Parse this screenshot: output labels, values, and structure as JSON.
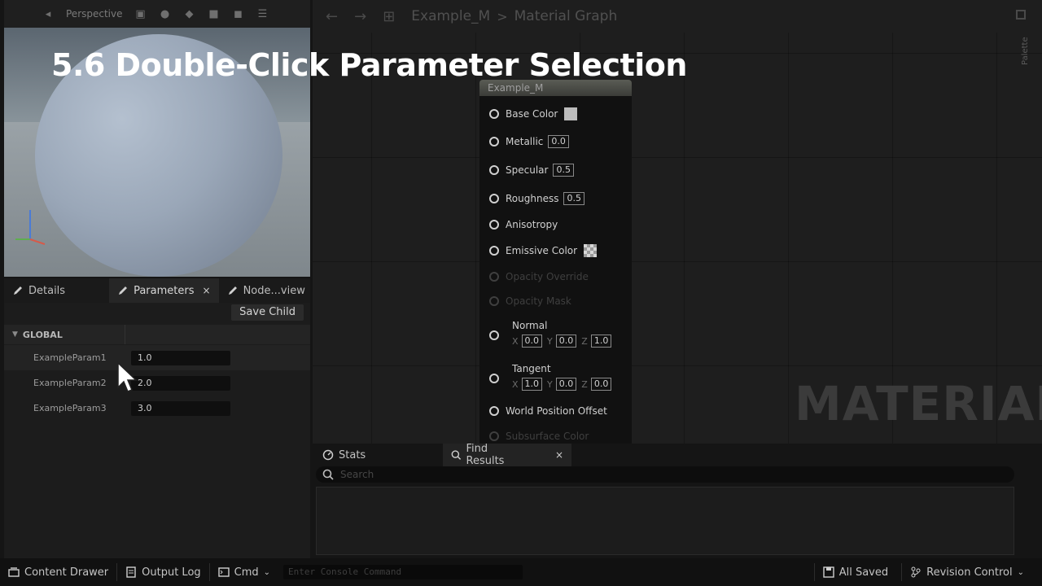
{
  "overlay_title": "5.6 Double-Click Parameter Selection",
  "viewport": {
    "mode_label": "Perspective"
  },
  "left_tabs": [
    {
      "label": "Details"
    },
    {
      "label": "Parameters",
      "close": "×"
    },
    {
      "label": "Node...view"
    }
  ],
  "params": {
    "save_child_label": "Save Child",
    "group_label": "GLOBAL",
    "rows": [
      {
        "name": "ExampleParam1",
        "value": "1.0"
      },
      {
        "name": "ExampleParam2",
        "value": "2.0"
      },
      {
        "name": "ExampleParam3",
        "value": "3.0"
      }
    ]
  },
  "graph": {
    "breadcrumb_root": "Example_M",
    "breadcrumb_sep": ">",
    "breadcrumb_leaf": "Material Graph",
    "palette_label": "Palette",
    "watermark": "MATERIAL"
  },
  "node": {
    "title": "Example_M",
    "pins": [
      {
        "label": "Base Color"
      },
      {
        "label": "Metallic",
        "value": "0.0"
      },
      {
        "label": "Specular",
        "value": "0.5"
      },
      {
        "label": "Roughness",
        "value": "0.5"
      },
      {
        "label": "Anisotropy"
      },
      {
        "label": "Emissive Color"
      },
      {
        "label": "Opacity Override"
      },
      {
        "label": "Opacity Mask"
      },
      {
        "label": "Normal",
        "x": "0.0",
        "y": "0.0",
        "z": "1.0"
      },
      {
        "label": "Tangent",
        "x": "1.0",
        "y": "0.0",
        "z": "0.0"
      },
      {
        "label": "World Position Offset"
      },
      {
        "label": "Subsurface Color"
      }
    ],
    "axis_x": "X",
    "axis_y": "Y",
    "axis_z": "Z"
  },
  "bottom_tabs": {
    "stats_label": "Stats",
    "find_label": "Find Results",
    "find_close": "×",
    "search_placeholder": "Search"
  },
  "statusbar": {
    "content_drawer": "Content Drawer",
    "output_log": "Output Log",
    "cmd": "Cmd",
    "console_placeholder": "Enter Console Command",
    "all_saved": "All Saved",
    "revision_control": "Revision Control"
  },
  "colors": {
    "accent_white": "#ffffff",
    "panel_bg": "#1c1c1c",
    "graph_bg": "#1e1e1e"
  }
}
